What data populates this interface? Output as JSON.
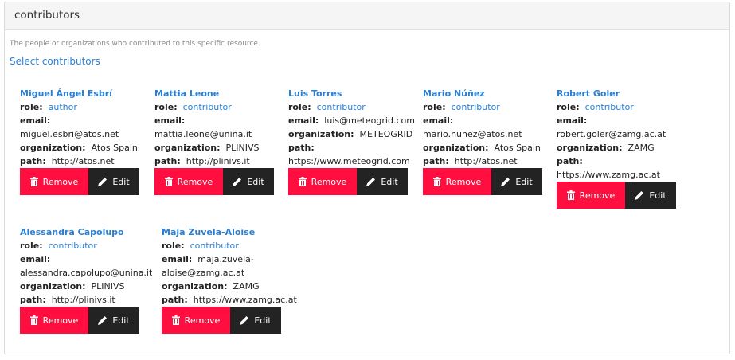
{
  "header": {
    "title": "contributors"
  },
  "description": "The people or organizations who contributed to this specific resource.",
  "select_link": "Select contributors",
  "labels": {
    "role": "role:",
    "email": "email:",
    "organization": "organization:",
    "path": "path:",
    "remove": "Remove",
    "edit": "Edit"
  },
  "contributors": [
    {
      "name": "Miguel Ángel Esbrí",
      "role": "author",
      "email": "miguel.esbri@atos.net",
      "organization": "Atos Spain",
      "path": "http://atos.net"
    },
    {
      "name": "Mattia Leone",
      "role": "contributor",
      "email": "mattia.leone@unina.it",
      "organization": "PLINIVS",
      "path": "http://plinivs.it"
    },
    {
      "name": "Luis Torres",
      "role": "contributor",
      "email": "luis@meteogrid.com",
      "organization": "METEOGRID",
      "path": "https://www.meteogrid.com"
    },
    {
      "name": "Mario Núñez",
      "role": "contributor",
      "email": "mario.nunez@atos.net",
      "organization": "Atos Spain",
      "path": "http://atos.net"
    },
    {
      "name": "Robert Goler",
      "role": "contributor",
      "email": "robert.goler@zamg.ac.at",
      "organization": "ZAMG",
      "path": "https://www.zamg.ac.at"
    },
    {
      "name": "Alessandra Capolupo",
      "role": "contributor",
      "email": "alessandra.capolupo@unina.it",
      "organization": "PLINIVS",
      "path": "http://plinivs.it"
    },
    {
      "name": "Maja Zuvela-Aloise",
      "role": "contributor",
      "email": "maja.zuvela-aloise@zamg.ac.at",
      "organization": "ZAMG",
      "path": "https://www.zamg.ac.at"
    }
  ],
  "colors": {
    "link": "#2a7fd4",
    "remove": "#ff0e3f",
    "edit": "#232323"
  }
}
